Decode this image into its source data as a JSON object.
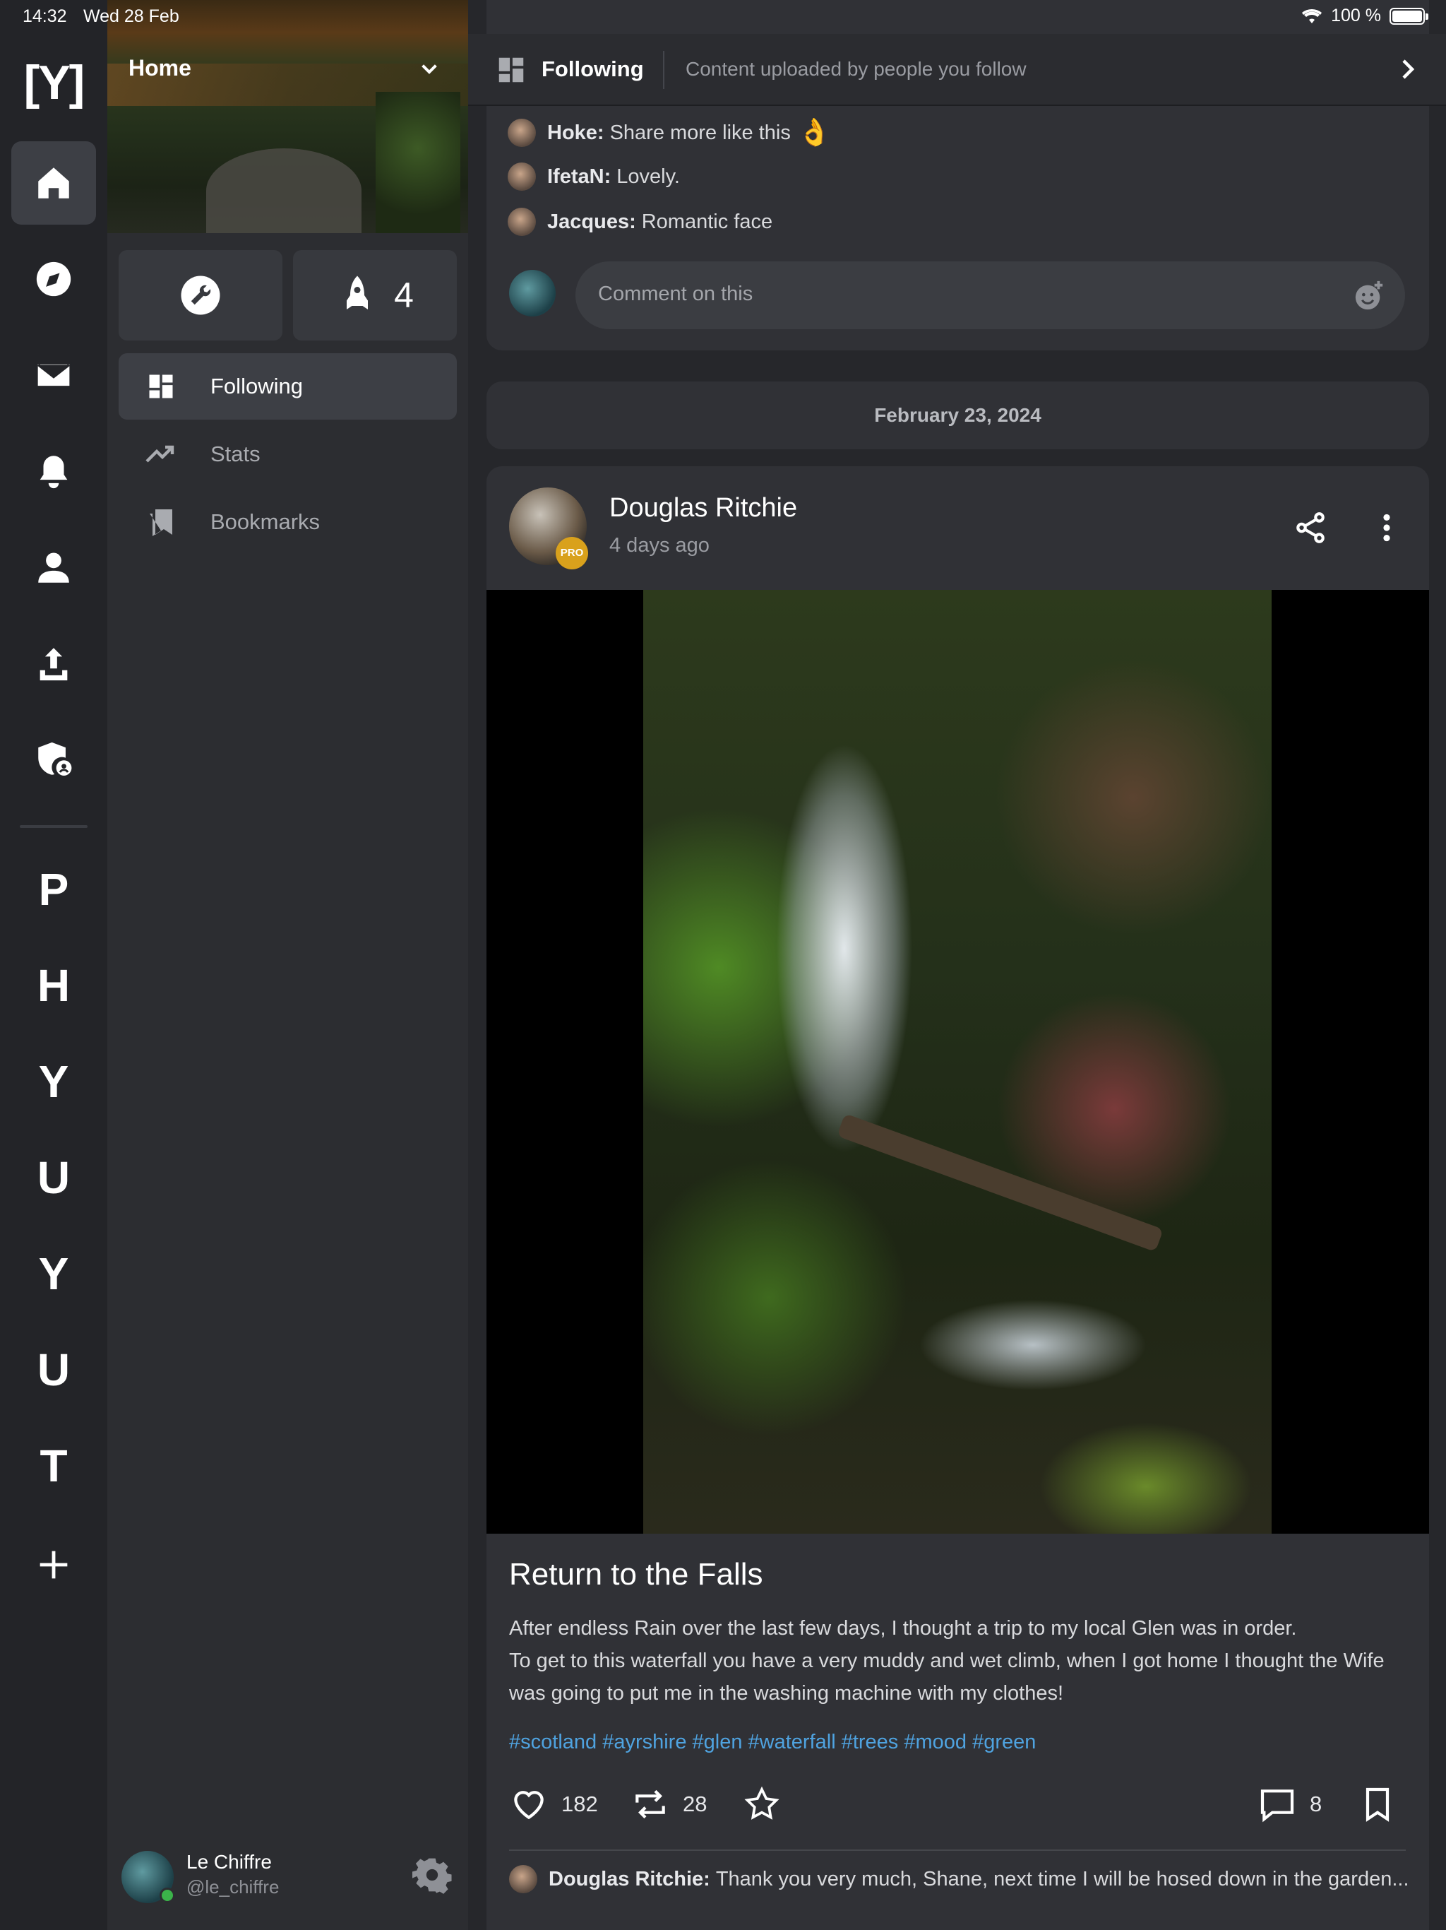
{
  "status_bar": {
    "time": "14:32",
    "date": "Wed 28 Feb",
    "battery": "100 %"
  },
  "rail": {
    "logo": "[Y]",
    "icons": [
      "home-icon",
      "compass-icon",
      "mail-icon",
      "bell-icon",
      "person-icon",
      "upload-icon",
      "shield-user-icon"
    ],
    "letters": [
      "P",
      "H",
      "Y",
      "U",
      "Y",
      "U",
      "T"
    ],
    "add_icon": "plus-icon"
  },
  "panel": {
    "dropdown": "Home",
    "boost_count": "4",
    "nav": [
      {
        "label": "Following",
        "icon": "dashboard-icon",
        "active": true
      },
      {
        "label": "Stats",
        "icon": "trending-icon",
        "active": false
      },
      {
        "label": "Bookmarks",
        "icon": "bookmarks-icon",
        "active": false
      }
    ],
    "user": {
      "name": "Le Chiffre",
      "handle": "@le_chiffre"
    }
  },
  "topbar": {
    "title": "Following",
    "subtitle": "Content uploaded by people you follow"
  },
  "prev_comments": [
    {
      "author": "Hoke:",
      "text": "Share more like this",
      "emoji": "👌"
    },
    {
      "author": "IfetaN:",
      "text": "Lovely."
    },
    {
      "author": "Jacques:",
      "text": "Romantic face"
    }
  ],
  "comment_placeholder": "Comment on this",
  "date_divider": "February 23, 2024",
  "post": {
    "author": "Douglas Ritchie",
    "badge": "PRO",
    "time": "4 days ago",
    "title": "Return to the Falls",
    "body": [
      "After endless Rain over the last few days, I thought a trip to my local Glen was in order.",
      "To get to this waterfall you have a very muddy and wet climb, when I got home I thought the Wife was going to put me in the washing machine with my clothes!"
    ],
    "tags": "#scotland #ayrshire #glen #waterfall #trees #mood #green",
    "likes": "182",
    "reposts": "28",
    "comments": "8",
    "first_comment": {
      "author": "Douglas Ritchie:",
      "text": "Thank you very much, Shane, next time I will be hosed down in the garden..."
    }
  },
  "colors": {
    "accent": "#4fa3e0",
    "pro": "#d9a11c",
    "online": "#3bb34a"
  }
}
